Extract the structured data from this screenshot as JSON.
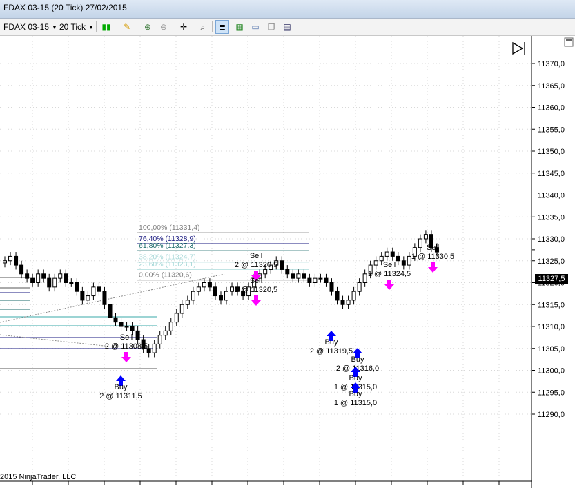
{
  "window": {
    "title": "FDAX 03-15 (20 Tick)  27/02/2015"
  },
  "toolbar": {
    "instrument": "FDAX 03-15",
    "interval": "20 Tick",
    "icons": [
      "bar-type-icon",
      "pencil-draw-icon",
      "zoom-in-icon",
      "zoom-out-icon",
      "crosshair-icon",
      "search-icon",
      "chart-properties-icon",
      "candlestick-icon",
      "data-box-icon",
      "copy-icon",
      "instrument-list-icon"
    ]
  },
  "price_axis": {
    "ticks": [
      "11370,0",
      "11365,0",
      "11360,0",
      "11355,0",
      "11350,0",
      "11345,0",
      "11340,0",
      "11335,0",
      "11330,0",
      "11325,0",
      "11320,0",
      "11315,0",
      "11310,0",
      "11305,0",
      "11300,0",
      "11295,0",
      "11290,0"
    ],
    "last_price": "11327,5"
  },
  "fib_labels": [
    "100,00% (11331,4)",
    "76,40% (11328,9)",
    "61,80% (11327,3)",
    "38,20% (11324,7)",
    "23,60% (11323,1)",
    "0,00% (11320,6)"
  ],
  "trades": [
    {
      "side": "Sell",
      "text": "2 @ 11320,5"
    },
    {
      "side": "Sell",
      "text": "2 @ 11320,5"
    },
    {
      "side": "Sell",
      "text": "2 @ 11308,5"
    },
    {
      "side": "Buy",
      "text": "2 @ 11311,5"
    },
    {
      "side": "Buy",
      "text": "2 @ 11319,5"
    },
    {
      "side": "Buy",
      "text": "2 @ 11316,0"
    },
    {
      "side": "Buy",
      "text": "1 @ 11315,0"
    },
    {
      "side": "Buy",
      "text": "1 @ 11315,0"
    },
    {
      "side": "Sell",
      "text": "1 @ 11324,5"
    },
    {
      "side": "Sell",
      "text": "1 @ 11330,5"
    }
  ],
  "copyright": "2015 NinjaTrader, LLC",
  "chart_data": {
    "type": "candlestick",
    "ylim": [
      11288,
      11375
    ],
    "tick_step": 5,
    "closes": [
      11325,
      11326,
      11324,
      11322,
      11321,
      11320,
      11322,
      11321,
      11319,
      11321,
      11322,
      11320,
      11320,
      11318,
      11316,
      11317,
      11319,
      11318,
      11315,
      11312,
      11311,
      11310,
      11310,
      11309,
      11307,
      11305,
      11304,
      11306,
      11308,
      11309,
      11311,
      11313,
      11315,
      11316,
      11318,
      11319,
      11320,
      11319,
      11317,
      11316,
      11318,
      11319,
      11318,
      11317,
      11319,
      11321,
      11322,
      11323,
      11324,
      11325,
      11323,
      11322,
      11321,
      11322,
      11321,
      11320,
      11321,
      11321,
      11320,
      11318,
      11316,
      11315,
      11316,
      11318,
      11320,
      11322,
      11324,
      11325,
      11326,
      11327,
      11326,
      11325,
      11324,
      11326,
      11328,
      11330,
      11331,
      11328,
      11327
    ],
    "fib_levels": [
      11331.4,
      11328.9,
      11327.3,
      11324.7,
      11323.1,
      11320.6
    ]
  }
}
